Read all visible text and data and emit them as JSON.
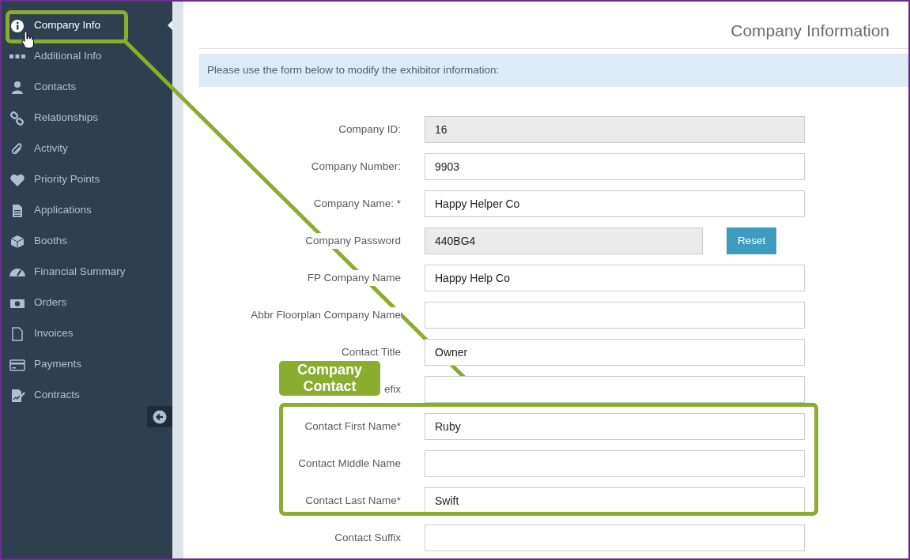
{
  "sidebar": {
    "items": [
      {
        "label": "Company Info",
        "selected": true
      },
      {
        "label": "Additional Info",
        "selected": false
      },
      {
        "label": "Contacts",
        "selected": false
      },
      {
        "label": "Relationships",
        "selected": false
      },
      {
        "label": "Activity",
        "selected": false
      },
      {
        "label": "Priority Points",
        "selected": false
      },
      {
        "label": "Applications",
        "selected": false
      },
      {
        "label": "Booths",
        "selected": false
      },
      {
        "label": "Financial Summary",
        "selected": false
      },
      {
        "label": "Orders",
        "selected": false
      },
      {
        "label": "Invoices",
        "selected": false
      },
      {
        "label": "Payments",
        "selected": false
      },
      {
        "label": "Contracts",
        "selected": false
      }
    ]
  },
  "page": {
    "title": "Company Information",
    "notice": "Please use the form below to modify the exhibitor information:"
  },
  "form": {
    "fields": [
      {
        "label": "Company ID:",
        "value": "16",
        "readonly": true
      },
      {
        "label": "Company Number:",
        "value": "9903",
        "readonly": false
      },
      {
        "label": "Company Name: *",
        "value": "Happy Helper Co",
        "readonly": false
      },
      {
        "label": "Company Password",
        "value": "440BG4",
        "readonly": true,
        "button": "Reset"
      },
      {
        "label": "FP Company Name",
        "value": "Happy Help Co",
        "readonly": false
      },
      {
        "label": "Abbr Floorplan Company Name",
        "readonly": false
      },
      {
        "label": "Contact Title",
        "value": "Owner",
        "readonly": false
      },
      {
        "label": "efix",
        "readonly": false
      },
      {
        "label": "Contact First Name*",
        "value": "Ruby",
        "readonly": false
      },
      {
        "label": "Contact Middle Name",
        "readonly": false
      },
      {
        "label": "Contact Last Name*",
        "value": "Swift",
        "readonly": false
      },
      {
        "label": "Contact Suffix",
        "readonly": false
      }
    ]
  },
  "annotation": {
    "callout": "Company Contact"
  }
}
